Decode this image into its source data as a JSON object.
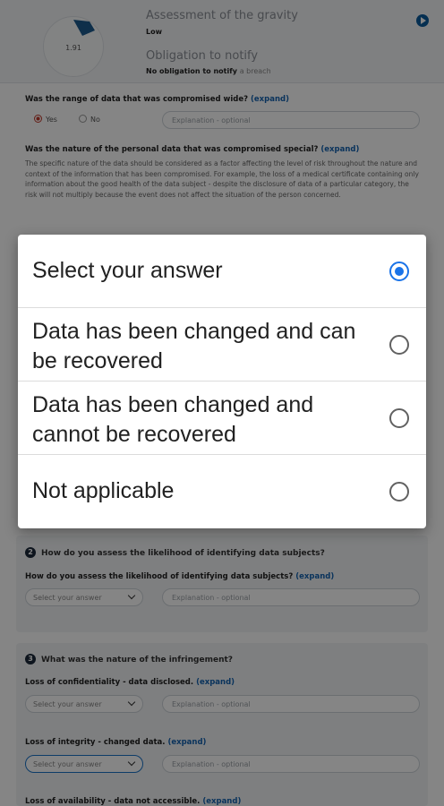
{
  "summary": {
    "gauge_value": "1.91",
    "gravity_label": "Assessment of the gravity",
    "gravity_value": "Low",
    "obligation_label": "Obligation to notify",
    "obligation_value": "No obligation to notify",
    "obligation_suffix": "a breach"
  },
  "form": {
    "q_range": "Was the range of data that was compromised wide?",
    "expand": "(expand)",
    "yes": "Yes",
    "no": "No",
    "explanation_placeholder": "Explanation - optional",
    "q_nature": "Was the nature of the personal data that was compromised special?",
    "nature_paragraph": "The specific nature of the data should be considered as a factor affecting the level of risk throughout the nature and context of the information that has been compromised. For example, the loss of a medical certificate containing only information about the good health of the data subject - despite the disclosure of data of a particular category, the risk will not multiply because the event does not affect the situation of the person concerned.",
    "section2_num": "2",
    "section2_title": "How do you assess the likelihood of identifying data subjects?",
    "q_likelihood": "How do you assess the likelihood of identifying data subjects?",
    "select_placeholder": "Select your answer",
    "section3_num": "3",
    "section3_title": "What was the nature of the infringement?",
    "q_confidentiality": "Loss of confidentiality - data disclosed.",
    "q_integrity": "Loss of integrity - changed data.",
    "q_availability": "Loss of availability - data not accessible."
  },
  "dialog": {
    "options": [
      {
        "label": "Select your answer",
        "checked": true
      },
      {
        "label": "Data has been changed and can be recovered",
        "checked": false
      },
      {
        "label": "Data has been changed and cannot be recovered",
        "checked": false
      },
      {
        "label": "Not applicable",
        "checked": false
      }
    ]
  },
  "colors": {
    "accent": "#1a73e8",
    "link": "#1463b0",
    "overlay": "rgba(0,0,0,0.48)"
  }
}
